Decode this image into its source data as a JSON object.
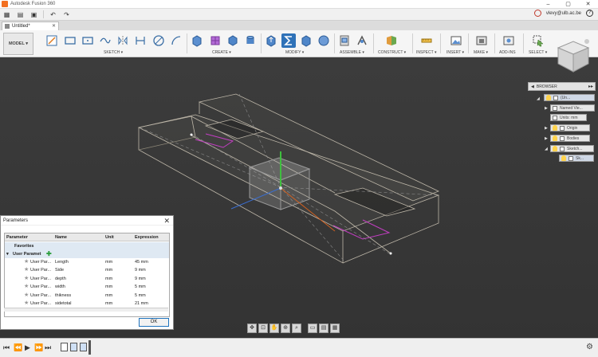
{
  "window": {
    "title": "Autodesk Fusion 360",
    "controls": [
      "–",
      "▢",
      "✕"
    ]
  },
  "account": {
    "user": "vlevy@ulb.ac.be"
  },
  "document_tab": {
    "label": "Untitled*"
  },
  "workspace": {
    "label": "MODEL ▾"
  },
  "toolbar_groups": [
    {
      "label": "SKETCH ▾"
    },
    {
      "label": "CREATE ▾"
    },
    {
      "label": "MODIFY ▾"
    },
    {
      "label": "ASSEMBLE ▾"
    },
    {
      "label": "CONSTRUCT ▾"
    },
    {
      "label": "INSPECT ▾"
    },
    {
      "label": "INSERT ▾"
    },
    {
      "label": "MAKE ▾"
    },
    {
      "label": "ADD-INS"
    },
    {
      "label": "SELECT ▾"
    }
  ],
  "browser": {
    "title": "BROWSER",
    "nodes": [
      {
        "label": "(Un..."
      },
      {
        "label": "Named Vie..."
      },
      {
        "label": "Units: mm"
      },
      {
        "label": "Origin"
      },
      {
        "label": "Bodies"
      },
      {
        "label": "Sketch..."
      },
      {
        "label": "Sk..."
      }
    ]
  },
  "parameters_dialog": {
    "title": "Parameters",
    "columns": [
      "Parameter",
      "Name",
      "Unit",
      "Expression"
    ],
    "favorites_label": "Favorites",
    "group_label": "User Paramet",
    "rows": [
      {
        "parameter": "User Par...",
        "name": "Length",
        "unit": "mm",
        "expression": "45 mm"
      },
      {
        "parameter": "User Par...",
        "name": "Side",
        "unit": "mm",
        "expression": "9 mm"
      },
      {
        "parameter": "User Par...",
        "name": "depth",
        "unit": "mm",
        "expression": "9 mm"
      },
      {
        "parameter": "User Par...",
        "name": "width",
        "unit": "mm",
        "expression": "5 mm"
      },
      {
        "parameter": "User Par...",
        "name": "thikness",
        "unit": "mm",
        "expression": "5 mm"
      },
      {
        "parameter": "User Par...",
        "name": "sidetotal",
        "unit": "mm",
        "expression": "21 mm"
      }
    ],
    "ok_label": "OK"
  }
}
